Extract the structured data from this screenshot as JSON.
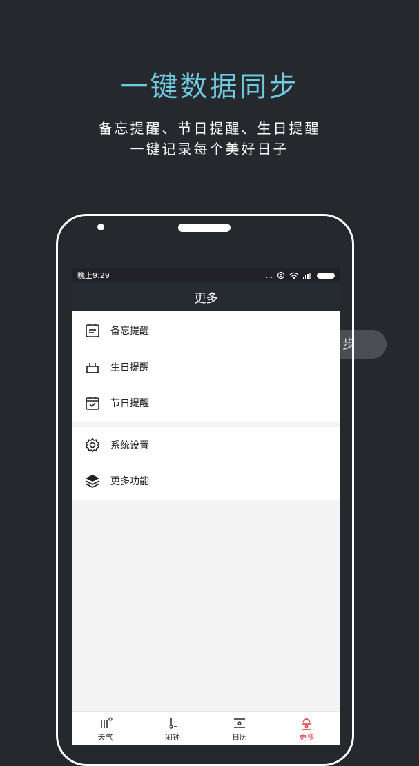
{
  "promo": {
    "headline": "一键数据同步",
    "line1": "备忘提醒、节日提醒、生日提醒",
    "line2": "一键记录每个美好日子"
  },
  "floating_pill": {
    "text": "步"
  },
  "status_bar": {
    "time": "晚上9:29",
    "dots": "..."
  },
  "nav": {
    "title": "更多"
  },
  "menu": {
    "group1": [
      {
        "label": "备忘提醒",
        "icon": "memo-icon"
      },
      {
        "label": "生日提醒",
        "icon": "cake-icon"
      },
      {
        "label": "节日提醒",
        "icon": "calendar-check-icon"
      }
    ],
    "group2": [
      {
        "label": "系统设置",
        "icon": "gear-icon"
      },
      {
        "label": "更多功能",
        "icon": "layers-icon"
      }
    ]
  },
  "tabs": [
    {
      "label": "天气",
      "icon": "weather-icon",
      "active": false
    },
    {
      "label": "闹钟",
      "icon": "alarm-icon",
      "active": false
    },
    {
      "label": "日历",
      "icon": "calendar-icon",
      "active": false
    },
    {
      "label": "更多",
      "icon": "more-icon",
      "active": true
    }
  ],
  "colors": {
    "accent": "#6fcbe0",
    "active_tab": "#d94444",
    "background": "#25282d"
  }
}
